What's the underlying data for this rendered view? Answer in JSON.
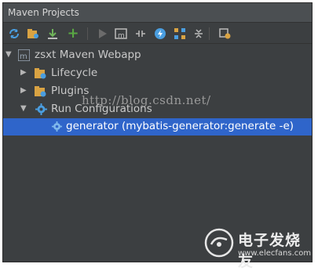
{
  "panel": {
    "title": "Maven Projects"
  },
  "toolbar": {
    "icons": [
      "reimport-icon",
      "generate-sources-icon",
      "download-icon",
      "add-icon",
      "run-icon",
      "maven-goal-icon",
      "toggle-offline-icon",
      "skip-tests-icon",
      "show-dependencies-icon",
      "collapse-all-icon",
      "settings-icon"
    ]
  },
  "tree": {
    "root": "zsxt Maven Webapp",
    "lifecycle": "Lifecycle",
    "plugins": "Plugins",
    "run_configurations": "Run Configurations",
    "generator": "generator (mybatis-generator:generate -e)"
  },
  "watermark": "http://blog.csdn.net/",
  "logo": {
    "cn": "电子发烧友",
    "en": "www.elecfans.com"
  },
  "colors": {
    "panel_bg": "#3c3f41",
    "selection": "#2f65ca",
    "text": "#c9c9c9"
  }
}
